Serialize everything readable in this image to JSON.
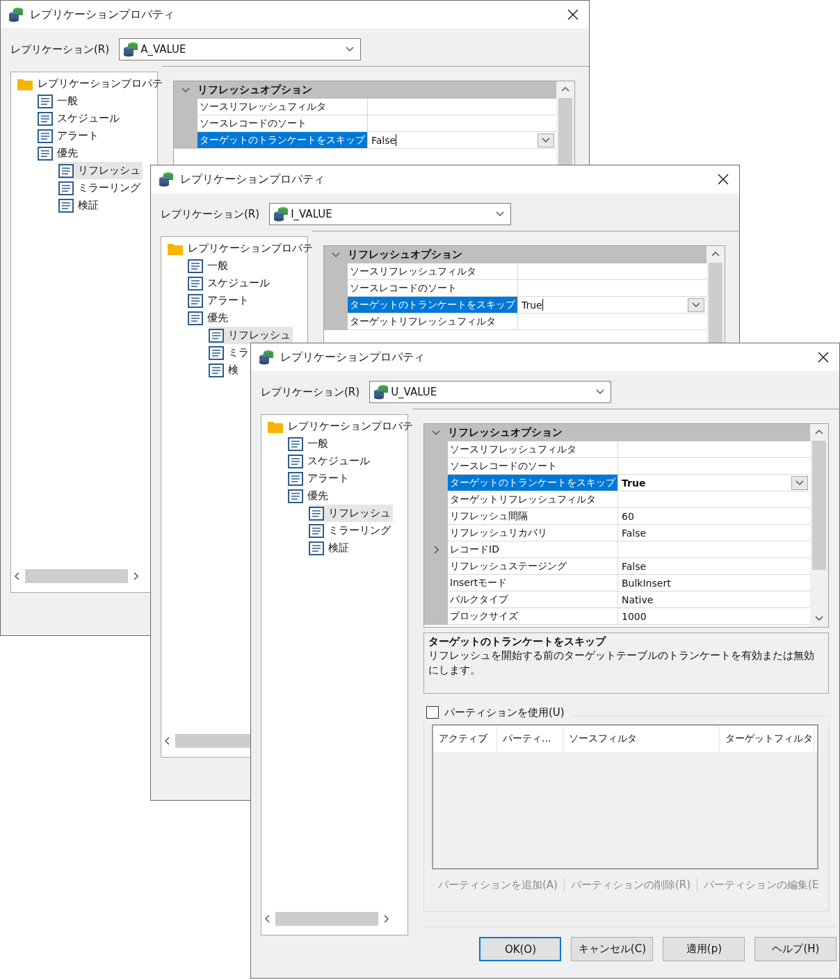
{
  "windows": [
    {
      "title": "レプリケーションプロパティ",
      "replication_label": "レプリケーション(R)",
      "replication_value": "A_VALUE",
      "tree": [
        {
          "label": "レプリケーションプロパテ",
          "kind": "folder",
          "selected": false,
          "children": [
            {
              "label": "一般",
              "kind": "page",
              "selected": false
            },
            {
              "label": "スケジュール",
              "kind": "page",
              "selected": false
            },
            {
              "label": "アラート",
              "kind": "page",
              "selected": false
            },
            {
              "label": "優先",
              "kind": "page",
              "selected": false,
              "children": [
                {
                  "label": "リフレッシュ",
                  "kind": "page",
                  "selected": true
                },
                {
                  "label": "ミラーリング",
                  "kind": "page",
                  "selected": false
                },
                {
                  "label": "検証",
                  "kind": "page",
                  "selected": false
                }
              ]
            }
          ]
        }
      ],
      "property_grid": {
        "category": "リフレッシュオプション",
        "expanded": true,
        "rows": [
          {
            "name": "ソースリフレッシュフィルタ",
            "selected": false
          },
          {
            "name": "ソースレコードのソート",
            "selected": false
          },
          {
            "name": "ターゲットのトランケートをスキップ",
            "value": "False",
            "selected": true,
            "editing": true
          }
        ]
      }
    },
    {
      "title": "レプリケーションプロパティ",
      "replication_label": "レプリケーション(R)",
      "replication_value": "I_VALUE",
      "tree": [
        {
          "label": "レプリケーションプロパテ",
          "kind": "folder",
          "selected": false,
          "children": [
            {
              "label": "一般",
              "kind": "page",
              "selected": false
            },
            {
              "label": "スケジュール",
              "kind": "page",
              "selected": false
            },
            {
              "label": "アラート",
              "kind": "page",
              "selected": false
            },
            {
              "label": "優先",
              "kind": "page",
              "selected": false,
              "children": [
                {
                  "label": "リフレッシュ",
                  "kind": "page",
                  "selected": true
                },
                {
                  "label": "ミラ",
                  "kind": "page",
                  "selected": false
                },
                {
                  "label": "検",
                  "kind": "page",
                  "selected": false
                }
              ]
            }
          ]
        }
      ],
      "property_grid": {
        "category": "リフレッシュオプション",
        "expanded": true,
        "rows": [
          {
            "name": "ソースリフレッシュフィルタ",
            "selected": false
          },
          {
            "name": "ソースレコードのソート",
            "selected": false
          },
          {
            "name": "ターゲットのトランケートをスキップ",
            "value": "True",
            "selected": true,
            "editing": true
          },
          {
            "name": "ターゲットリフレッシュフィルタ",
            "selected": false
          }
        ]
      }
    },
    {
      "title": "レプリケーションプロパティ",
      "replication_label": "レプリケーション(R)",
      "replication_value": "U_VALUE",
      "tree": [
        {
          "label": "レプリケーションプロパテ",
          "kind": "folder",
          "selected": false,
          "children": [
            {
              "label": "一般",
              "kind": "page",
              "selected": false
            },
            {
              "label": "スケジュール",
              "kind": "page",
              "selected": false
            },
            {
              "label": "アラート",
              "kind": "page",
              "selected": false
            },
            {
              "label": "優先",
              "kind": "page",
              "selected": false,
              "children": [
                {
                  "label": "リフレッシュ",
                  "kind": "page",
                  "selected": true
                },
                {
                  "label": "ミラーリング",
                  "kind": "page",
                  "selected": false
                },
                {
                  "label": "検証",
                  "kind": "page",
                  "selected": false
                }
              ]
            }
          ]
        }
      ],
      "property_grid": {
        "category": "リフレッシュオプション",
        "expanded": true,
        "rows": [
          {
            "name": "ソースリフレッシュフィルタ",
            "selected": false,
            "expandable": false
          },
          {
            "name": "ソースレコードのソート",
            "selected": false,
            "expandable": false
          },
          {
            "name": "ターゲットのトランケートをスキップ",
            "value": "True",
            "selected": true,
            "editing": false,
            "expandable": false
          },
          {
            "name": "ターゲットリフレッシュフィルタ",
            "selected": false,
            "expandable": false
          },
          {
            "name": "リフレッシュ間隔",
            "value": "60",
            "selected": false,
            "expandable": false
          },
          {
            "name": "リフレッシュリカバリ",
            "value": "False",
            "selected": false,
            "expandable": false
          },
          {
            "name": "レコードID",
            "selected": false,
            "expandable": true
          },
          {
            "name": "リフレッシュステージング",
            "value": "False",
            "selected": false,
            "expandable": false
          },
          {
            "name": "Insertモード",
            "value": "BulkInsert",
            "selected": false,
            "expandable": false
          },
          {
            "name": "バルクタイプ",
            "value": "Native",
            "selected": false,
            "expandable": false
          },
          {
            "name": "ブロックサイズ",
            "value": "1000",
            "selected": false,
            "expandable": false
          }
        ]
      },
      "description": {
        "title": "ターゲットのトランケートをスキップ",
        "text": "リフレッシュを開始する前のターゲットテーブルのトランケートを有効または無効にします。"
      },
      "partitions": {
        "label": "パーティションを使用(U)",
        "checked": false,
        "columns": [
          "アクティブ",
          "パーティ...",
          "ソースフィルタ",
          "ターゲットフィルタ"
        ],
        "toolbar": [
          {
            "label": "パーティションを追加(A)",
            "disabled": true
          },
          {
            "label": "パーティションの削除(R)",
            "disabled": true
          },
          {
            "label": "パーティションの編集(E",
            "disabled": true
          }
        ]
      },
      "buttons": [
        {
          "label": "OK(O)",
          "default": true
        },
        {
          "label": "キャンセル(C)",
          "default": false
        },
        {
          "label": "適用(p)",
          "default": false
        },
        {
          "label": "ヘルプ(H)",
          "default": false
        }
      ]
    }
  ]
}
